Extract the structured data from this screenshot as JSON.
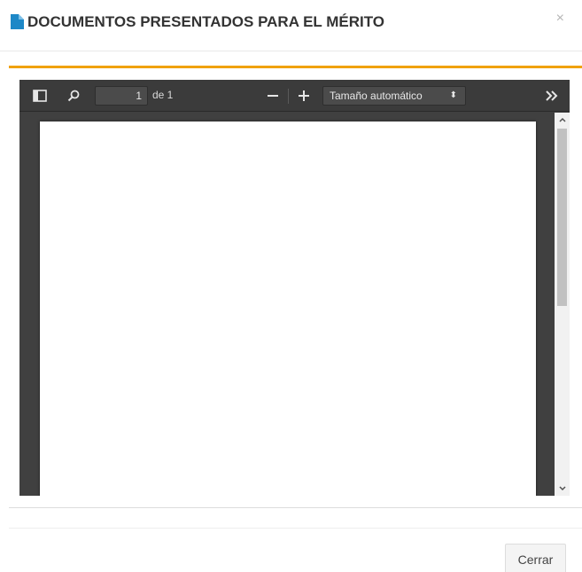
{
  "modal": {
    "title": "DOCUMENTOS PRESENTADOS PARA EL MÉRITO",
    "title_icon": "document-icon",
    "close_symbol": "×",
    "accent_color": "#f0a20e",
    "icon_color": "#1e88c7"
  },
  "viewer": {
    "page_number": "1",
    "page_count": "de 1",
    "zoom_out": "−",
    "zoom_in": "+",
    "scale": "Tamaño automático",
    "scale_arrow": "⬍",
    "more": "»",
    "icons": [
      "sidebar-toggle-icon",
      "search-icon",
      "zoom-out-icon",
      "zoom-in-icon",
      "tools-icon",
      "chevron-up-icon",
      "chevron-down-icon"
    ]
  },
  "footer": {
    "close_label": "Cerrar"
  }
}
